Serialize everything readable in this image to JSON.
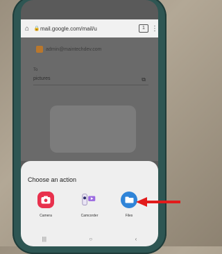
{
  "browser": {
    "url": "mail.google.com/mail/u",
    "tab_count": "1"
  },
  "compose": {
    "from": "admin@maintechdev.com",
    "to_label": "To",
    "subject": "pictures"
  },
  "sheet": {
    "title": "Choose an action",
    "actions": [
      {
        "label": "Camera",
        "icon": "camera-icon",
        "color": "#e8314d"
      },
      {
        "label": "Camcorder",
        "icon": "camcorder-icon",
        "color": "#9b6ae0"
      },
      {
        "label": "Files",
        "icon": "folder-icon",
        "color": "#2f84d8"
      }
    ]
  },
  "nav": {
    "recents": "|||",
    "home": "○",
    "back": "‹"
  },
  "colors": {
    "case": "#2e5653",
    "arrow": "#e21b1b",
    "sheet": "#efefef"
  }
}
